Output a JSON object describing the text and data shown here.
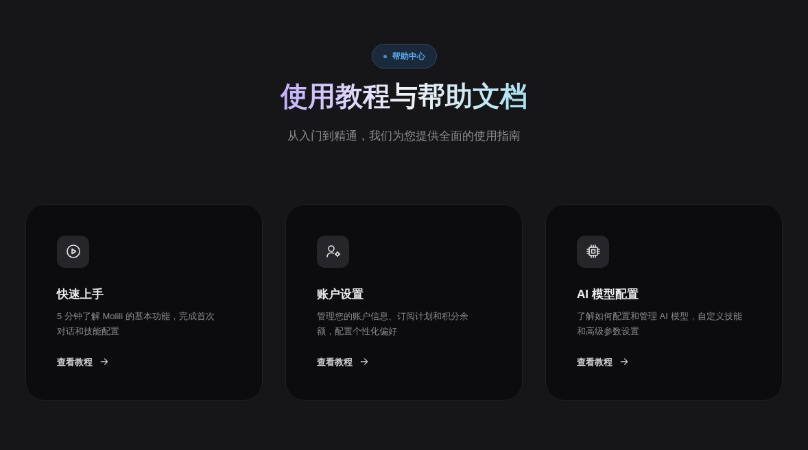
{
  "badge": {
    "label": "帮助中心"
  },
  "title": "使用教程与帮助文档",
  "subtitle": "从入门到精通，我们为您提供全面的使用指南",
  "cards": [
    {
      "kind": "play",
      "title": "快速上手",
      "description": "5 分钟了解 Molili 的基本功能，完成首次对话和技能配置",
      "link": "查看教程"
    },
    {
      "kind": "account",
      "title": "账户设置",
      "description": "管理您的账户信息、订阅计划和积分余额，配置个性化偏好",
      "link": "查看教程"
    },
    {
      "kind": "model",
      "title": "AI 模型配置",
      "description": "了解如何配置和管理 AI 模型，自定义技能和高级参数设置",
      "link": "查看教程"
    }
  ]
}
